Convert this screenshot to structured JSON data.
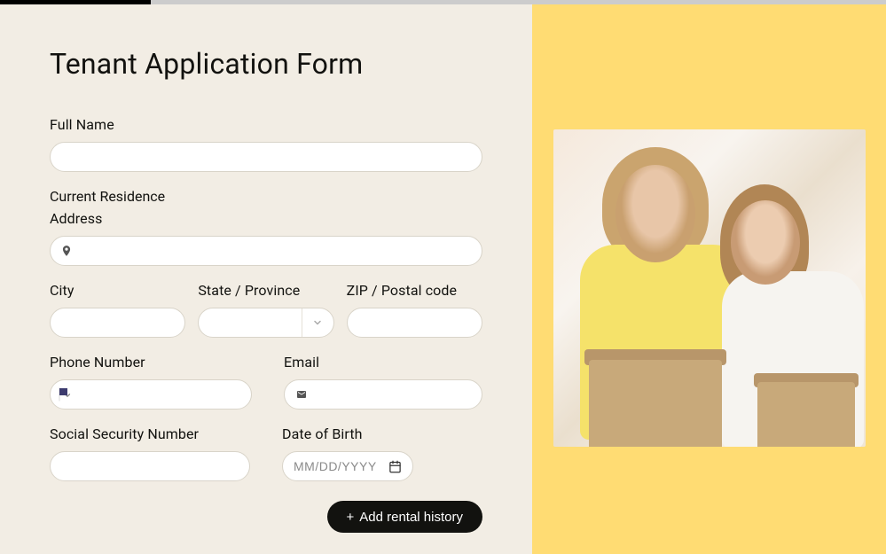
{
  "title": "Tenant Application Form",
  "fields": {
    "full_name_label": "Full Name",
    "full_name_value": "",
    "current_residence_heading": "Current Residence",
    "address_label": "Address",
    "address_value": "",
    "city_label": "City",
    "city_value": "",
    "state_label": "State / Province",
    "state_value": "",
    "zip_label": "ZIP / Postal code",
    "zip_value": "",
    "phone_label": "Phone Number",
    "phone_value": "",
    "phone_country": "US",
    "email_label": "Email",
    "email_value": "",
    "ssn_label": "Social Security Number",
    "ssn_value": "",
    "dob_label": "Date of Birth",
    "dob_value": "",
    "dob_placeholder": "MM/DD/YYYY"
  },
  "buttons": {
    "add_rental_history": "Add rental history"
  },
  "icons": {
    "location_pin": "location-pin-icon",
    "envelope": "envelope-icon",
    "calendar": "calendar-icon",
    "chevron_down": "chevron-down-icon",
    "us_flag": "us-flag-icon"
  }
}
